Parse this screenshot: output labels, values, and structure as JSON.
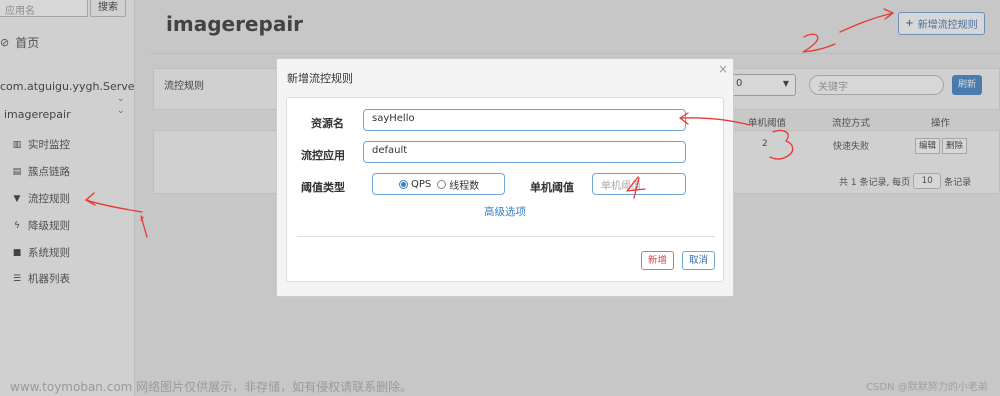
{
  "sidebar": {
    "search_placeholder": "应用名",
    "search_button": "搜索",
    "home": "首页",
    "app_name": "com.atguigu.yygh.ServerGat",
    "sub_app": "imagerepair",
    "items": [
      {
        "label": "实时监控",
        "icon": "bar-chart-icon"
      },
      {
        "label": "簇点链路",
        "icon": "list-icon"
      },
      {
        "label": "流控规则",
        "icon": "filter-icon"
      },
      {
        "label": "降级规则",
        "icon": "bolt-icon"
      },
      {
        "label": "系统规则",
        "icon": "lock-icon"
      },
      {
        "label": "机器列表",
        "icon": "grid-list-icon"
      }
    ]
  },
  "main": {
    "title": "imagerepair",
    "add_rule_button": "新增流控规则",
    "panel_title": "流控规则",
    "select_value": "0",
    "keyword_placeholder": "关键字",
    "refresh_button": "刷新",
    "columns": [
      "单机阈值",
      "流控方式",
      "操作"
    ],
    "row": {
      "threshold": "2",
      "mode": "快速失败",
      "edit": "编辑",
      "delete": "删除"
    },
    "pager": {
      "summary": "共 1 条记录, 每页",
      "page_size": "10",
      "unit": "条记录"
    }
  },
  "modal": {
    "title": "新增流控规则",
    "close": "×",
    "resource_label": "资源名",
    "resource_value": "sayHello",
    "app_label": "流控应用",
    "app_value": "default",
    "threshold_type_label": "阈值类型",
    "radio_qps": "QPS",
    "radio_threads": "线程数",
    "single_threshold_label": "单机阈值",
    "single_threshold_placeholder": "单机阈值",
    "advanced_link": "高级选项",
    "add_button": "新增",
    "cancel_button": "取消"
  },
  "annotations": {
    "n1": "1",
    "n2": "2",
    "n3": "3",
    "n4": "4",
    "color": "#e53935"
  },
  "watermark": "www.toymoban.com 网络图片仅供展示，非存储，如有侵权请联系删除。",
  "credit": "CSDN @默默努力的小老弟"
}
